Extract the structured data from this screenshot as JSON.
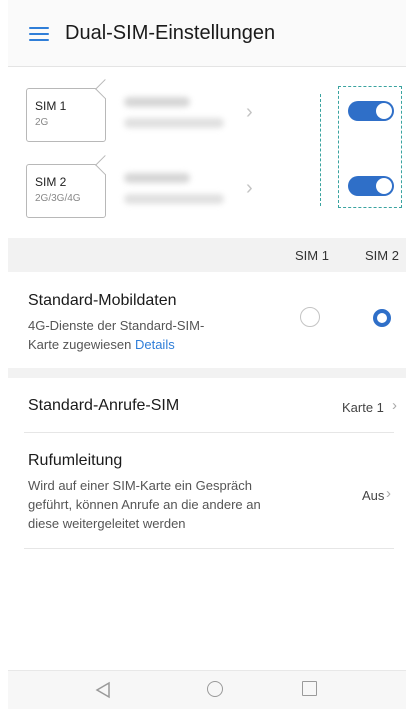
{
  "header": {
    "title": "Dual-SIM-Einstellungen",
    "menu_icon": "hamburger-menu-icon"
  },
  "sims": [
    {
      "name": "SIM 1",
      "type": "2G",
      "enabled": true
    },
    {
      "name": "SIM 2",
      "type": "2G/3G/4G",
      "enabled": true
    }
  ],
  "columns": {
    "sim1": "SIM 1",
    "sim2": "SIM 2"
  },
  "mobile_data": {
    "title": "Standard-Mobildaten",
    "subtitle_line1": "4G-Dienste der Standard-SIM-",
    "subtitle_line2": "Karte zugewiesen",
    "details_link": "Details",
    "selected": "SIM 2"
  },
  "call_sim": {
    "title": "Standard-Anrufe-SIM",
    "value": "Karte 1"
  },
  "forwarding": {
    "title": "Rufumleitung",
    "subtitle_line1": "Wird auf einer SIM-Karte ein Gespräch",
    "subtitle_line2": "geführt, können Anrufe an die andere an",
    "subtitle_line3": "diese weitergeleitet werden",
    "value": "Aus"
  },
  "colors": {
    "accent": "#2f6fc8",
    "link": "#2f7ed8",
    "highlight": "#3aa3a0"
  }
}
